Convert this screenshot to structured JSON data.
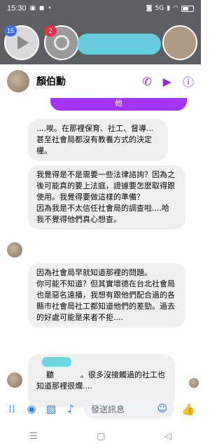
{
  "status_bar": {
    "time": "15:30",
    "signal": "5G",
    "battery_level": 0.5
  },
  "chat_heads": {
    "badge1": "15",
    "badge2": "2"
  },
  "header": {
    "contact_name": "顏伯勳"
  },
  "messages": {
    "outgoing_partial": "他",
    "m1": "....唉。在那裡保育、社工、督導...甚至社會局都沒有教養方式的決定權。",
    "m2": "我覺得是不是需要一些法律諮詢？因為之後可能真的要上法庭，證據要怎麼取得跟使用。我覺得要做這樣的準備？\n因為我是不太信任社會局的調查啦....哈\n我不覺得他們真心想查。",
    "m3": "因為社會局早就知道那裡的問題。\n你可能不知道？但其實壞德在台北社會局也是惡名遠播，我想有跟他們配合過的各縣市社會局社工都知道他們的差勁。過去的好處可能是來者不拒....",
    "m4_prefix": "聽",
    "m4_suffix": "。很多沒接觸過的社工也知道那裡很爛...."
  },
  "composer": {
    "placeholder": "發送訊息"
  }
}
